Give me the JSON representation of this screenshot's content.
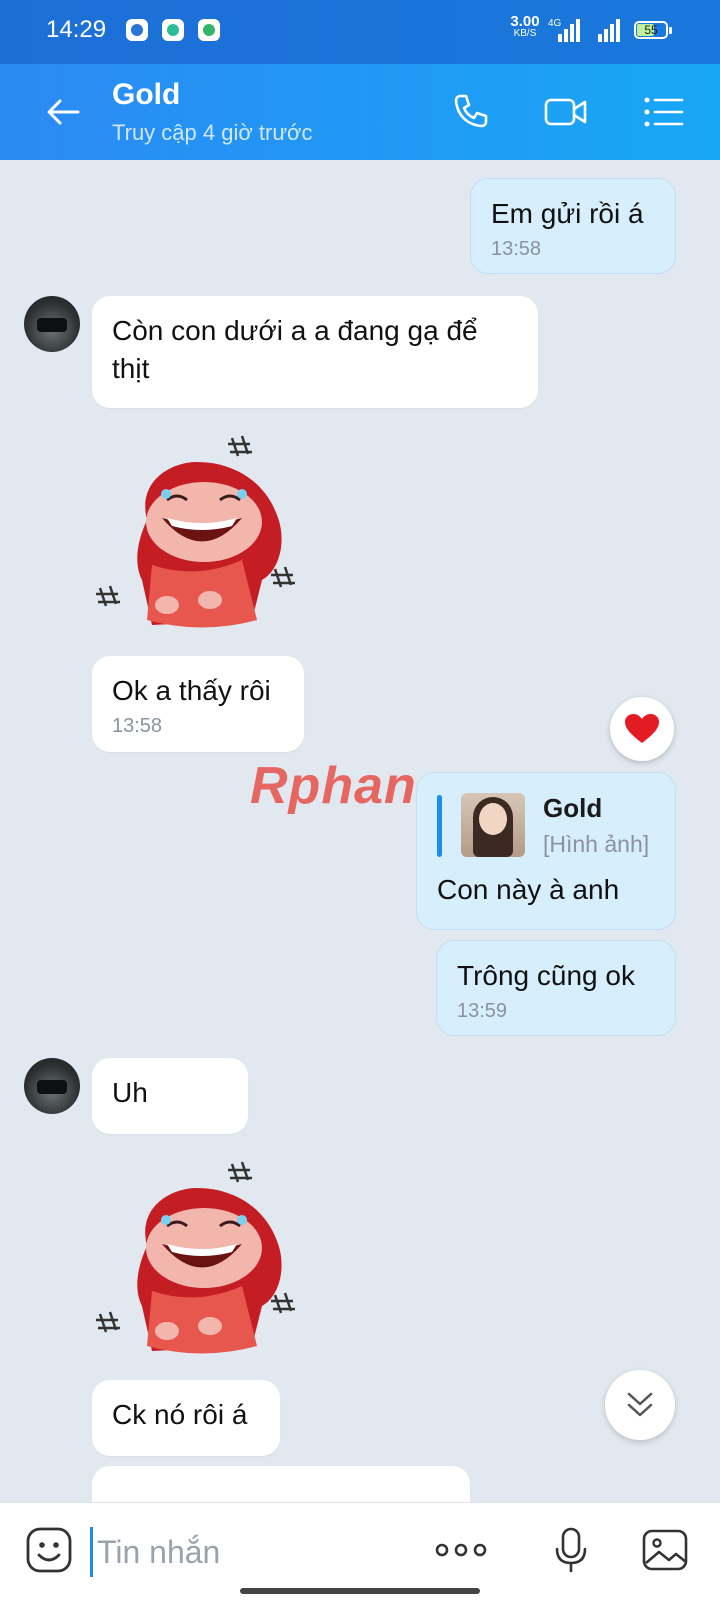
{
  "status_bar": {
    "time": "14:29",
    "net_speed": "3.00",
    "net_unit": "KB/S",
    "network": "4G",
    "battery": "55"
  },
  "header": {
    "name": "Gold",
    "last_seen": "Truy cập 4 giờ trước",
    "back_icon": "arrow-left-icon",
    "call_icon": "phone-icon",
    "video_icon": "video-camera-icon",
    "menu_icon": "list-menu-icon"
  },
  "messages": [
    {
      "type": "out",
      "text": "Em gửi rồi á",
      "time": "13:58"
    },
    {
      "type": "in",
      "text": "Còn con dưới a a đang gạ để thịt"
    },
    {
      "type": "sticker",
      "sticker": "laughing-red-hood-sticker"
    },
    {
      "type": "in",
      "text": "Ok a thấy rôi",
      "time": "13:58",
      "reaction": "heart"
    },
    {
      "type": "out-reply",
      "reply_name": "Gold",
      "reply_type": "[Hình ảnh]",
      "text": "Con này à anh"
    },
    {
      "type": "out",
      "text": "Trông cũng ok",
      "time": "13:59"
    },
    {
      "type": "in",
      "text": "Uh"
    },
    {
      "type": "sticker",
      "sticker": "laughing-red-hood-sticker"
    },
    {
      "type": "in",
      "text": "Ck nó rôi á"
    }
  ],
  "watermark": "Rphang",
  "input": {
    "placeholder": "Tin nhắn",
    "value": ""
  },
  "colors": {
    "header": "#2b8af4",
    "bubble_out": "#d7eefc",
    "bubble_in": "#ffffff",
    "background": "#e2e8f0",
    "accent": "#1a8ef0"
  }
}
